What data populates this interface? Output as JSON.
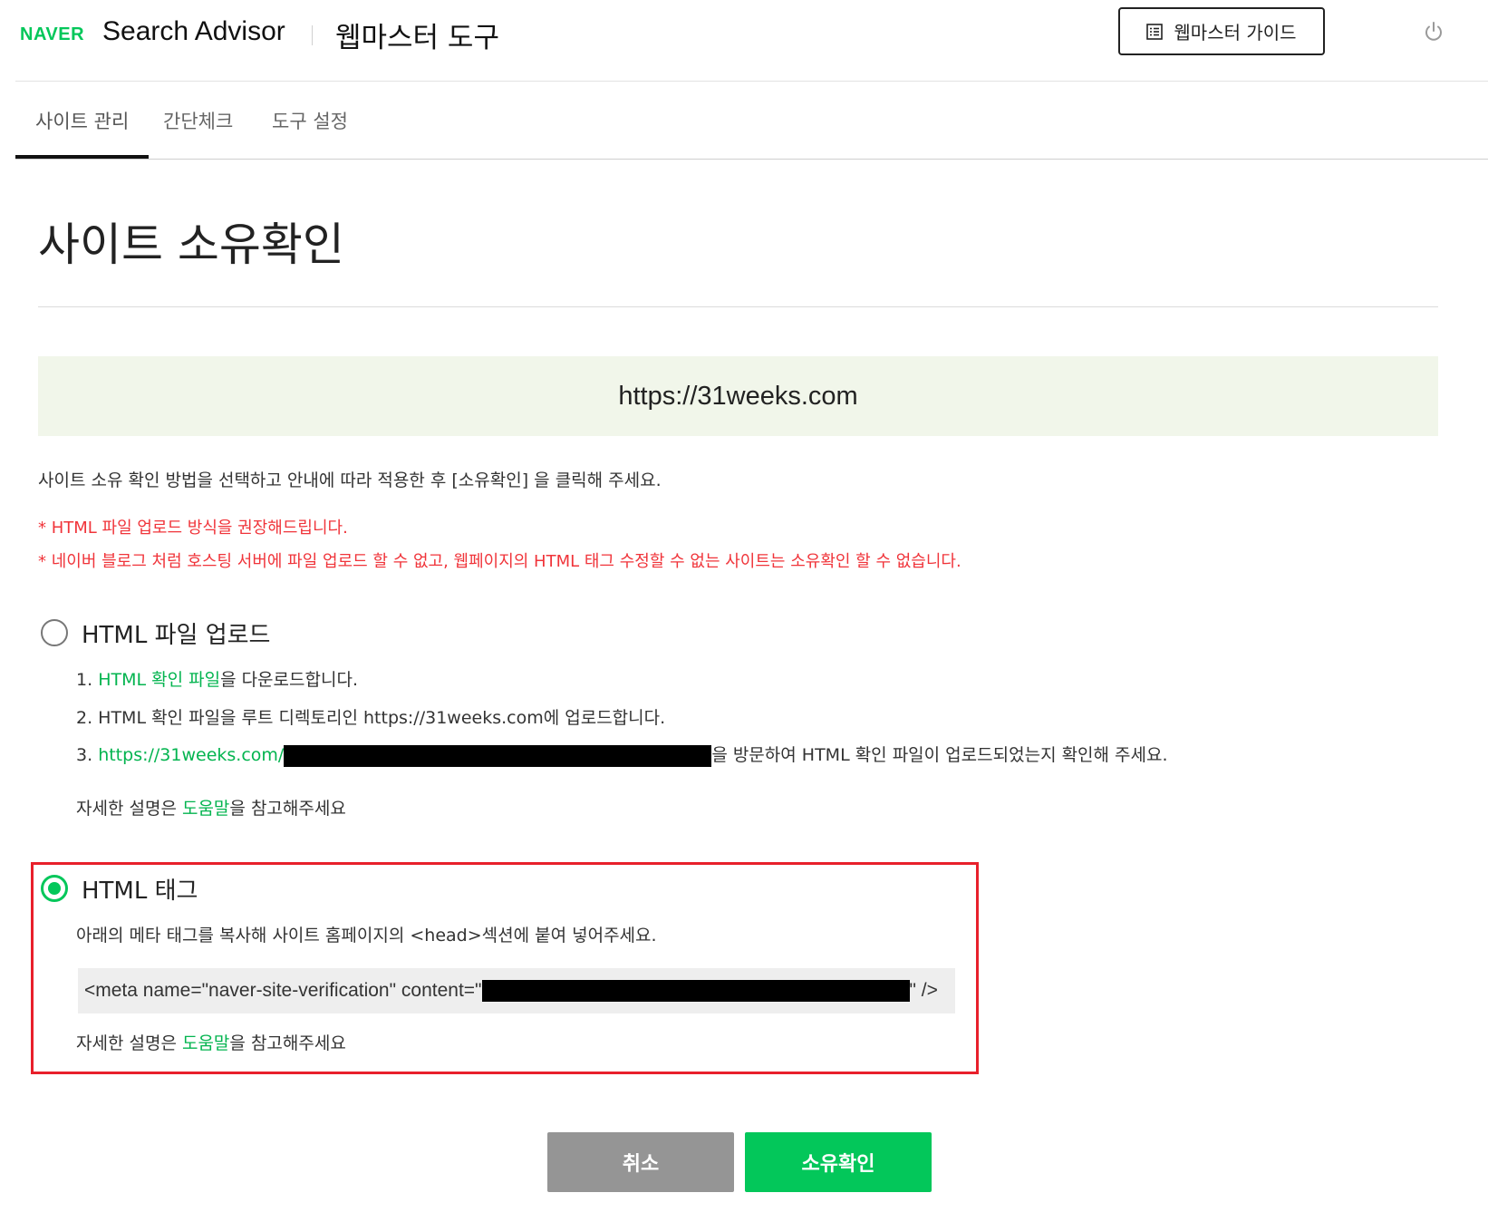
{
  "header": {
    "logo": "NAVER",
    "app_name": "Search Advisor",
    "tool_name": "웹마스터 도구",
    "guide_button": "웹마스터 가이드",
    "guide_icon": "list-icon",
    "power_icon": "power-icon"
  },
  "tabs": [
    {
      "label": "사이트 관리",
      "active": true
    },
    {
      "label": "간단체크",
      "active": false
    },
    {
      "label": "도구 설정",
      "active": false
    }
  ],
  "page_title": "사이트 소유확인",
  "site_url": "https://31weeks.com",
  "instruction": "사이트 소유 확인 방법을 선택하고 안내에 따라 적용한 후 [소유확인] 을 클릭해 주세요.",
  "warnings": [
    "* HTML 파일 업로드 방식을 권장해드립니다.",
    "* 네이버 블로그 처럼 호스팅 서버에 파일 업로드 할 수 없고, 웹페이지의 HTML 태그 수정할 수 없는 사이트는 소유확인 할 수 없습니다."
  ],
  "option_file": {
    "label": "HTML 파일 업로드",
    "selected": false,
    "step1_num": "1.",
    "step1_link": "HTML 확인 파일",
    "step1_rest": "을 다운로드합니다.",
    "step2": "2. HTML 확인 파일을 루트 디렉토리인 https://31weeks.com에 업로드합니다.",
    "step3_num": "3.",
    "step3_link": "https://31weeks.com/",
    "step3_rest": "을 방문하여 HTML 확인 파일이 업로드되었는지 확인해 주세요.",
    "help_prefix": "자세한 설명은 ",
    "help_link": "도움말",
    "help_suffix": "을 참고해주세요"
  },
  "option_tag": {
    "label": "HTML 태그",
    "selected": true,
    "description": "아래의 메타 태그를 복사해 사이트 홈페이지의 <head>섹션에 붙여 넣어주세요.",
    "meta_prefix": "<meta name=\"naver-site-verification\" content=\"",
    "meta_suffix": "\" />",
    "help_prefix": "자세한 설명은 ",
    "help_link": "도움말",
    "help_suffix": "을 참고해주세요"
  },
  "buttons": {
    "cancel": "취소",
    "confirm": "소유확인"
  },
  "colors": {
    "brand_green": "#03c75a",
    "warning_red": "#f0343a",
    "highlight_red": "#e8202b",
    "site_box_bg": "#f1f6ea",
    "cancel_gray": "#959595"
  }
}
